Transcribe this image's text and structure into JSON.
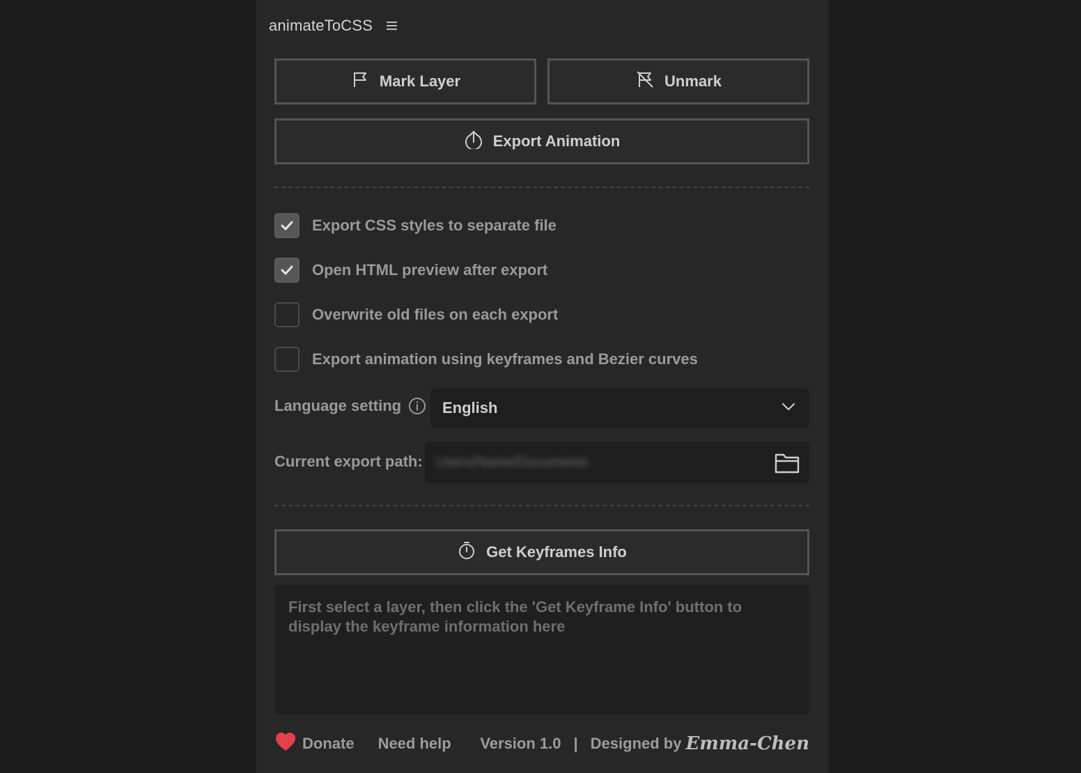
{
  "app": {
    "title": "animateToCSS"
  },
  "colors": {
    "panel_bg": "#272727",
    "outer_bg": "#1b1b1b",
    "heart": "#e53f4a"
  },
  "buttons": {
    "mark_layer": {
      "label": "Mark Layer",
      "icon": "flag-icon"
    },
    "unmark": {
      "label": "Unmark",
      "icon": "flag-off-icon"
    },
    "export_animation": {
      "label": "Export Animation",
      "icon": "upload-icon"
    },
    "get_keyframes": {
      "label": "Get Keyframes Info",
      "icon": "timer-icon"
    }
  },
  "options": [
    {
      "label": "Export CSS styles to separate file",
      "checked": true
    },
    {
      "label": "Open HTML preview after export",
      "checked": true
    },
    {
      "label": "Overwrite old files on each export",
      "checked": false
    },
    {
      "label": "Export animation using keyframes and Bezier curves",
      "checked": false
    }
  ],
  "language": {
    "label": "Language setting",
    "selected": "English"
  },
  "export_path": {
    "label": "Current export path:",
    "value": "Users/Name/Documents"
  },
  "keyframe_info": {
    "placeholder": "First select a layer, then click the 'Get Keyframe Info' button to display the keyframe information here"
  },
  "footer": {
    "donate": "Donate",
    "need_help": "Need help",
    "version": "Version 1.0",
    "separator": "|",
    "designed_by": "Designed by",
    "author": "Emma-Chen"
  }
}
